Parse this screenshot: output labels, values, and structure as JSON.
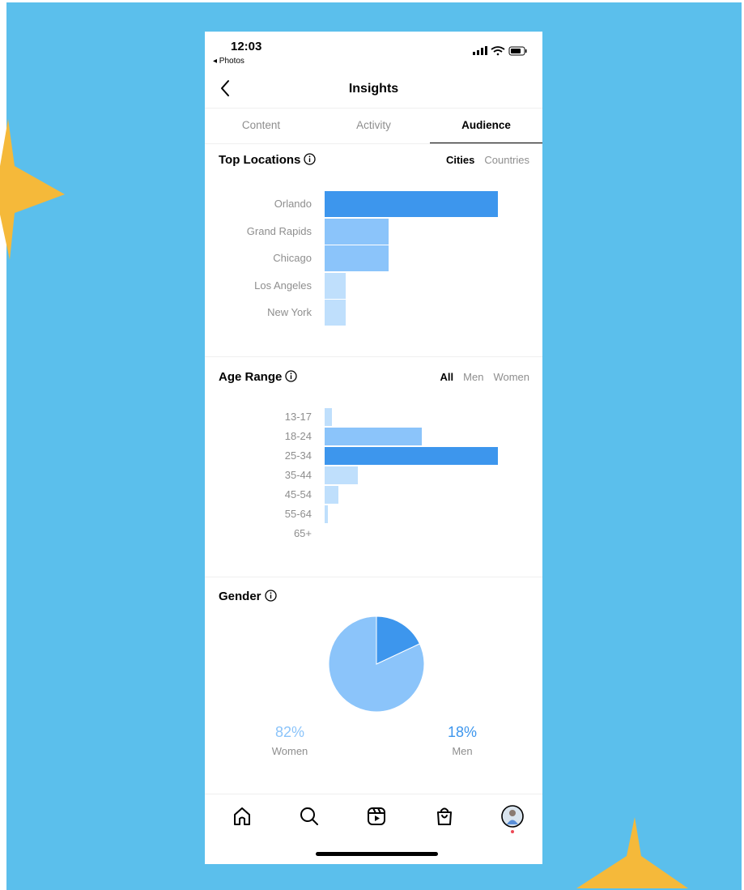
{
  "colors": {
    "background": "#5bbfec",
    "sparkle": "#f5b93a",
    "bar_dark": "#3d96ed",
    "bar_mid": "#8bc4fa",
    "bar_light": "#bfdffc"
  },
  "status_bar": {
    "time": "12:03",
    "back_app": "◂ Photos",
    "icons": [
      "signal-icon",
      "wifi-icon",
      "battery-icon"
    ]
  },
  "header": {
    "title": "Insights",
    "back_icon": "chevron-left-icon"
  },
  "tabs": [
    {
      "label": "Content",
      "active": false
    },
    {
      "label": "Activity",
      "active": false
    },
    {
      "label": "Audience",
      "active": true
    }
  ],
  "top_locations": {
    "title": "Top Locations",
    "toggles": [
      {
        "label": "Cities",
        "selected": true
      },
      {
        "label": "Countries",
        "selected": false
      }
    ]
  },
  "age_range": {
    "title": "Age Range",
    "toggles": [
      {
        "label": "All",
        "selected": true
      },
      {
        "label": "Men",
        "selected": false
      },
      {
        "label": "Women",
        "selected": false
      }
    ]
  },
  "gender": {
    "title": "Gender",
    "women": {
      "percent": "82%",
      "label": "Women"
    },
    "men": {
      "percent": "18%",
      "label": "Men"
    }
  },
  "bottom_nav": [
    "home-icon",
    "search-icon",
    "reels-icon",
    "shop-icon",
    "profile-avatar"
  ],
  "chart_data": [
    {
      "type": "bar",
      "orientation": "horizontal",
      "categories": [
        "Orlando",
        "Grand Rapids",
        "Chicago",
        "Los Angeles",
        "New York"
      ],
      "values": [
        100,
        37,
        37,
        12,
        12
      ],
      "value_scale": "percent of largest bar",
      "highlight": 0
    },
    {
      "type": "bar",
      "orientation": "horizontal",
      "categories": [
        "13-17",
        "18-24",
        "25-34",
        "35-44",
        "45-54",
        "55-64",
        "65+"
      ],
      "values": [
        4,
        56,
        100,
        19,
        8,
        2,
        0
      ],
      "value_scale": "percent of largest bar",
      "highlight": 2
    },
    {
      "type": "pie",
      "categories": [
        "Women",
        "Men"
      ],
      "values": [
        82,
        18
      ]
    }
  ]
}
